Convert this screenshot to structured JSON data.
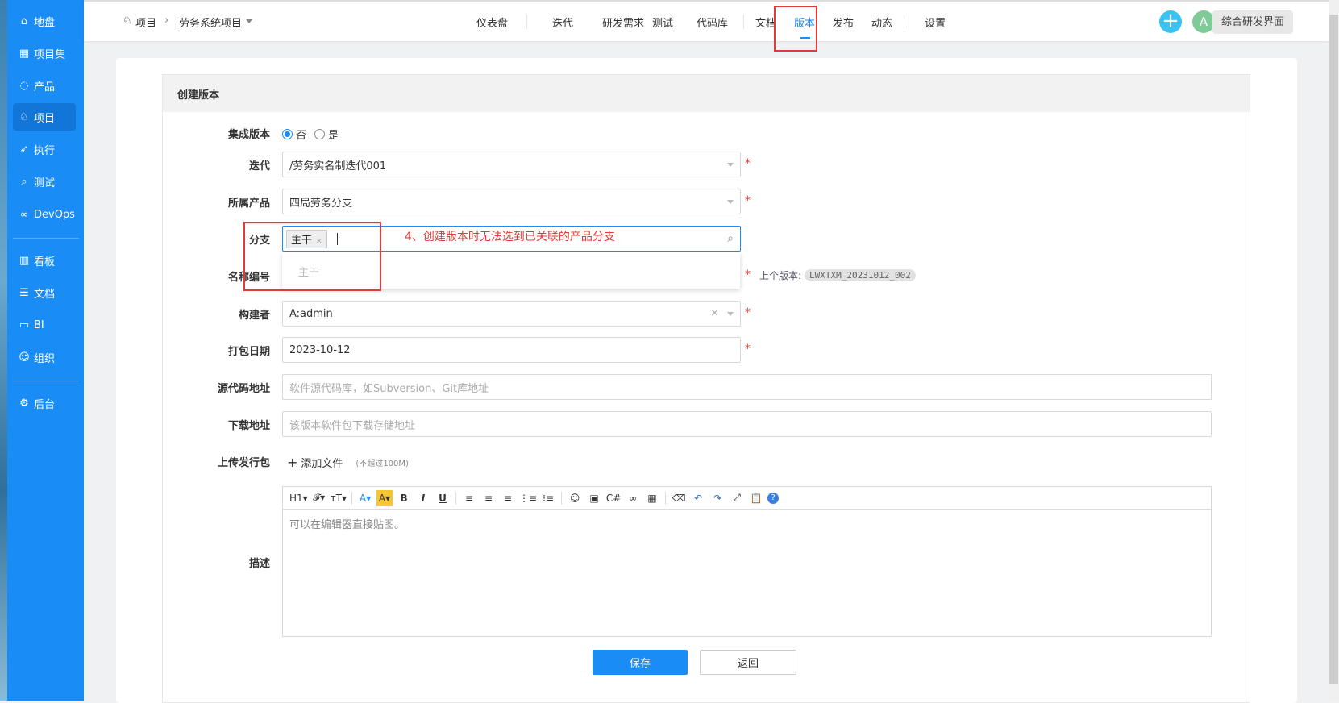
{
  "sidebar": {
    "items": [
      {
        "label": "地盘",
        "icon": "home-icon"
      },
      {
        "label": "项目集",
        "icon": "grid-icon"
      },
      {
        "label": "产品",
        "icon": "bulb-icon"
      },
      {
        "label": "项目",
        "icon": "rocket-icon",
        "active": true
      },
      {
        "label": "执行",
        "icon": "run-icon"
      },
      {
        "label": "测试",
        "icon": "search-icon"
      },
      {
        "label": "DevOps",
        "icon": "infinity-icon"
      },
      {
        "label": "看板",
        "icon": "board-icon"
      },
      {
        "label": "文档",
        "icon": "doc-icon"
      },
      {
        "label": "BI",
        "icon": "chart-icon"
      },
      {
        "label": "组织",
        "icon": "people-icon"
      },
      {
        "label": "后台",
        "icon": "gear-icon"
      }
    ]
  },
  "breadcrumb": {
    "root": "项目",
    "project": "劳务系统项目"
  },
  "nav": [
    "仪表盘",
    "迭代",
    "研发需求",
    "测试",
    "代码库",
    "文档",
    "版本",
    "发布",
    "动态",
    "设置"
  ],
  "nav_active": "版本",
  "header_right": {
    "add": "+",
    "avatar": "A",
    "switch": "综合研发界面"
  },
  "form": {
    "title": "创建版本",
    "integrated": {
      "label": "集成版本",
      "no": "否",
      "yes": "是"
    },
    "iteration": {
      "label": "迭代",
      "value": "/劳务实名制迭代001"
    },
    "product": {
      "label": "所属产品",
      "value": "四局劳务分支"
    },
    "branch": {
      "label": "分支",
      "tag": "主干",
      "tag_close": "×",
      "dropdown_option": "主干"
    },
    "name": {
      "label": "名称编号",
      "prev_label": "上个版本:",
      "prev_value": "LWXTXM_20231012_002"
    },
    "builder": {
      "label": "构建者",
      "value": "A:admin",
      "clear": "×"
    },
    "date": {
      "label": "打包日期",
      "value": "2023-10-12"
    },
    "scm": {
      "label": "源代码地址",
      "placeholder": "软件源代码库，如Subversion、Git库地址"
    },
    "download": {
      "label": "下载地址",
      "placeholder": "该版本软件包下载存储地址"
    },
    "upload": {
      "label": "上传发行包",
      "add": "添加文件",
      "limit": "(不超过100M)"
    },
    "desc": {
      "label": "描述",
      "placeholder": "可以在编辑器直接贴图。"
    },
    "required": "*",
    "save": "保存",
    "back": "返回"
  },
  "annotation": "4、创建版本时无法选到已关联的产品分支",
  "toolbar": [
    "H1▾",
    "𝓕▾",
    "ᴛT▾",
    "A▾",
    "A▾",
    "B",
    "I",
    "U",
    "≡",
    "≡",
    "≡",
    "⋮≡",
    "⁝≡",
    "☺",
    "▣",
    "C#",
    "∞",
    "▦",
    "⌫",
    "↶",
    "↷",
    "⤢",
    "📋",
    "?"
  ],
  "colors": {
    "accent": "#1a8cf5",
    "annotation": "#e53935",
    "avatar": "#7ecb98",
    "add": "#3ac3f0"
  }
}
